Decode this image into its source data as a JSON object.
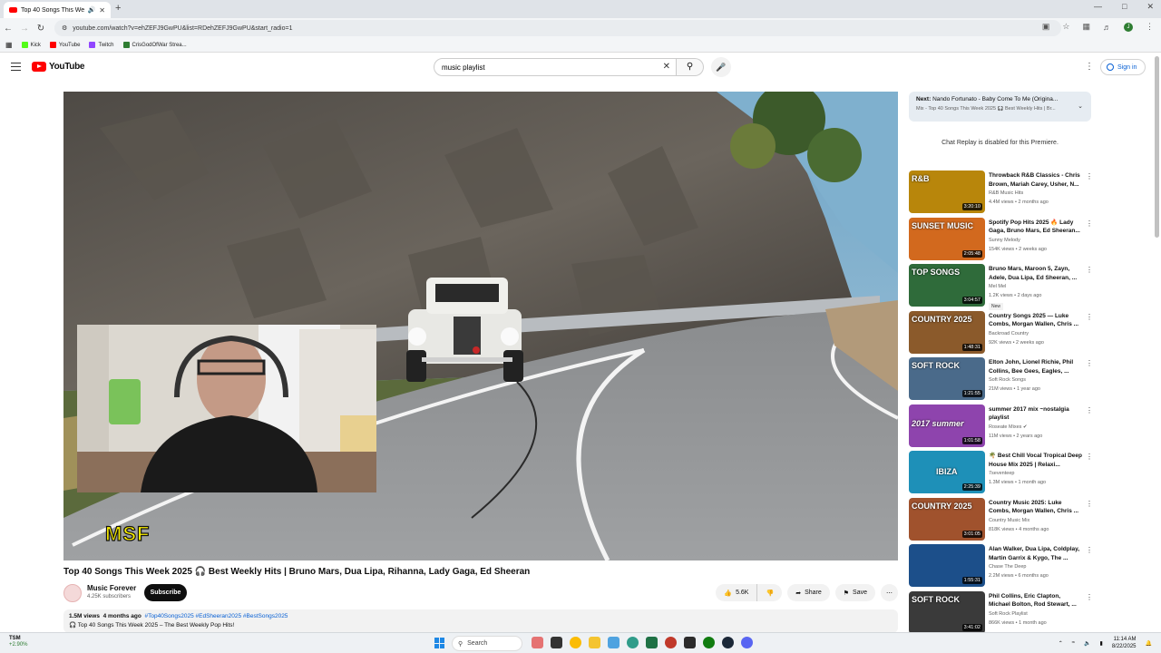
{
  "browser": {
    "tab_title": "Top 40 Songs This Week 20",
    "new_tab": "+",
    "url": "youtube.com/watch?v=ehZEFJ9GwPU&list=RDehZEFJ9GwPU&start_radio=1",
    "bookmarks": [
      {
        "label": "Kick",
        "color": "#53fc18"
      },
      {
        "label": "YouTube",
        "color": "#ff0000"
      },
      {
        "label": "Twitch",
        "color": "#9146ff"
      },
      {
        "label": "CrisGodOfWar Strea...",
        "color": "#2e7d32"
      }
    ],
    "profile_initial": "J"
  },
  "masthead": {
    "logo_text": "YouTube",
    "search_value": "music playlist",
    "signin_label": "Sign in"
  },
  "overlay": {
    "logo_text": "MSF"
  },
  "video": {
    "title": "Top 40 Songs This Week 2025 🎧 Best Weekly Hits | Bruno Mars, Dua Lipa, Rihanna, Lady Gaga, Ed Sheeran",
    "channel_name": "Music Forever",
    "subscribers": "4.25K subscribers",
    "subscribe_label": "Subscribe",
    "likes": "5.6K",
    "share_label": "Share",
    "save_label": "Save",
    "views": "1.5M views",
    "age": "4 months ago",
    "hashtags": "#Top40Songs2025 #EdSheeran2025 #BestSongs2025",
    "description_line": "🎧 Top 40 Songs This Week 2025 – The Best Weekly Pop Hits!"
  },
  "next_up": {
    "label": "Next:",
    "title": "Nando Fortunato - Baby Come To Me (Origina...",
    "playlist": "Mix - Top 40 Songs This Week 2025 🎧 Best Weekly Hits | Br..."
  },
  "chat_note": "Chat Replay is disabled for this Premiere.",
  "recommendations": [
    {
      "title": "Throwback R&B Classics - Chris Brown, Mariah Carey, Usher, N...",
      "channel": "R&B Music Hits",
      "meta": "4.4M views • 2 months ago",
      "duration": "3:20:10",
      "thumb_text": "R&B",
      "thumb_color": "#b8860b",
      "badge": ""
    },
    {
      "title": "Spotify Pop Hits 2025 🔥 Lady Gaga, Bruno Mars, Ed Sheeran...",
      "channel": "Sunny Melody",
      "meta": "154K views • 2 weeks ago",
      "duration": "2:05:48",
      "thumb_text": "SUNSET MUSIC",
      "thumb_color": "#d2691e",
      "badge": ""
    },
    {
      "title": "Bruno Mars, Maroon 5, Zayn, Adele, Dua Lipa, Ed Sheeran, ...",
      "channel": "Mel Mel",
      "meta": "1.2K views • 2 days ago",
      "duration": "3:04:57",
      "thumb_text": "TOP SONGS",
      "thumb_color": "#2f6b3a",
      "badge": "New"
    },
    {
      "title": "Country Songs 2025 — Luke Combs, Morgan Wallen, Chris ...",
      "channel": "Backroad Country",
      "meta": "92K views • 2 weeks ago",
      "duration": "1:48:31",
      "thumb_text": "COUNTRY 2025",
      "thumb_color": "#8b5a2b",
      "badge": ""
    },
    {
      "title": "Elton John, Lionel Richie, Phil Collins, Bee Gees, Eagles, ...",
      "channel": "Soft Rock Songs",
      "meta": "21M views • 1 year ago",
      "duration": "1:21:55",
      "thumb_text": "SOFT ROCK",
      "thumb_color": "#4a6a8a",
      "badge": ""
    },
    {
      "title": "summer 2017 mix ~nostalgia playlist",
      "channel": "Roseate Mixes",
      "meta": "11M views • 2 years ago",
      "duration": "1:01:58",
      "thumb_text": "2017 summer",
      "thumb_color": "#8e44ad",
      "badge": ""
    },
    {
      "title": "🌴 Best Chill Vocal Tropical Deep House Mix 2025 | Relaxi...",
      "channel": "7seventeep",
      "meta": "1.3M views • 1 month ago",
      "duration": "2:25:39",
      "thumb_text": "IBIZA",
      "thumb_color": "#1e90b8",
      "badge": ""
    },
    {
      "title": "Country Music 2025: Luke Combs, Morgan Wallen, Chris ...",
      "channel": "Country Music Mix",
      "meta": "818K views • 4 months ago",
      "duration": "3:01:05",
      "thumb_text": "COUNTRY 2025",
      "thumb_color": "#a0522d",
      "badge": ""
    },
    {
      "title": "Alan Walker, Dua Lipa, Coldplay, Martin Garrix & Kygo, The ...",
      "channel": "Chase The Deep",
      "meta": "2.2M views • 6 months ago",
      "duration": "1:55:31",
      "thumb_text": "",
      "thumb_color": "#1c4f8a",
      "badge": ""
    },
    {
      "title": "Phil Collins, Eric Clapton, Michael Bolton, Rod Stewart, ...",
      "channel": "Soft Rock Playlist",
      "meta": "866K views • 1 month ago",
      "duration": "3:41:02",
      "thumb_text": "SOFT ROCK",
      "thumb_color": "#3a3a3a",
      "badge": ""
    }
  ],
  "taskbar": {
    "stock": "TSM",
    "stock_change": "+2.90%",
    "search_label": "Search",
    "time": "11:14 AM",
    "date": "8/22/2025"
  }
}
